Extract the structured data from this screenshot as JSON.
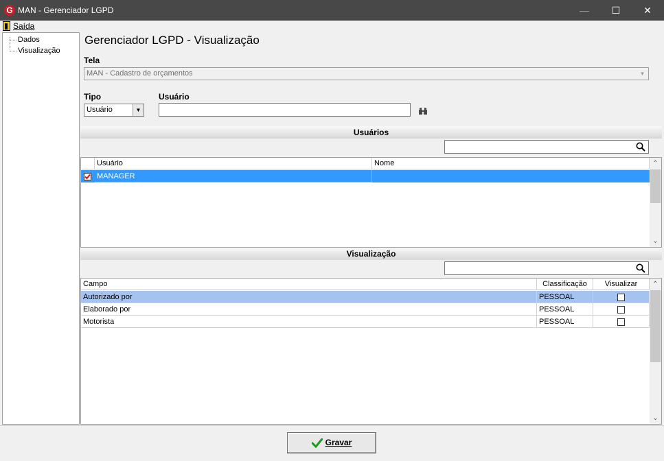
{
  "window": {
    "title": "MAN - Gerenciador LGPD",
    "app_icon": "G",
    "minimize": "—",
    "maximize": "☐",
    "close": "✕"
  },
  "menu": {
    "exit_label": "Saída"
  },
  "tree": {
    "items": [
      {
        "label": "Dados"
      },
      {
        "label": "Visualização"
      }
    ]
  },
  "page": {
    "title": "Gerenciador LGPD - Visualização"
  },
  "screen": {
    "label": "Tela",
    "value": "MAN - Cadastro de orçamentos"
  },
  "type": {
    "label": "Tipo",
    "value": "Usuário"
  },
  "user": {
    "label": "Usuário",
    "value": ""
  },
  "users_section": {
    "title": "Usuários",
    "search_value": "",
    "columns": [
      "",
      "Usuário",
      "Nome"
    ],
    "rows": [
      {
        "checked": true,
        "user": "MANAGER",
        "name": ""
      }
    ]
  },
  "view_section": {
    "title": "Visualização",
    "search_value": "",
    "columns": [
      "Campo",
      "Classificação",
      "Visualizar"
    ],
    "rows": [
      {
        "field": "Autorizado por",
        "classification": "PESSOAL",
        "visible": false
      },
      {
        "field": "Elaborado por",
        "classification": "PESSOAL",
        "visible": false
      },
      {
        "field": "Motorista",
        "classification": "PESSOAL",
        "visible": false
      }
    ]
  },
  "footer": {
    "save_label": "Gravar"
  },
  "colors": {
    "titlebar": "#484848",
    "selection": "#3399ff",
    "row_highlight": "#a6c2ee",
    "accent_red": "#c0202a"
  }
}
